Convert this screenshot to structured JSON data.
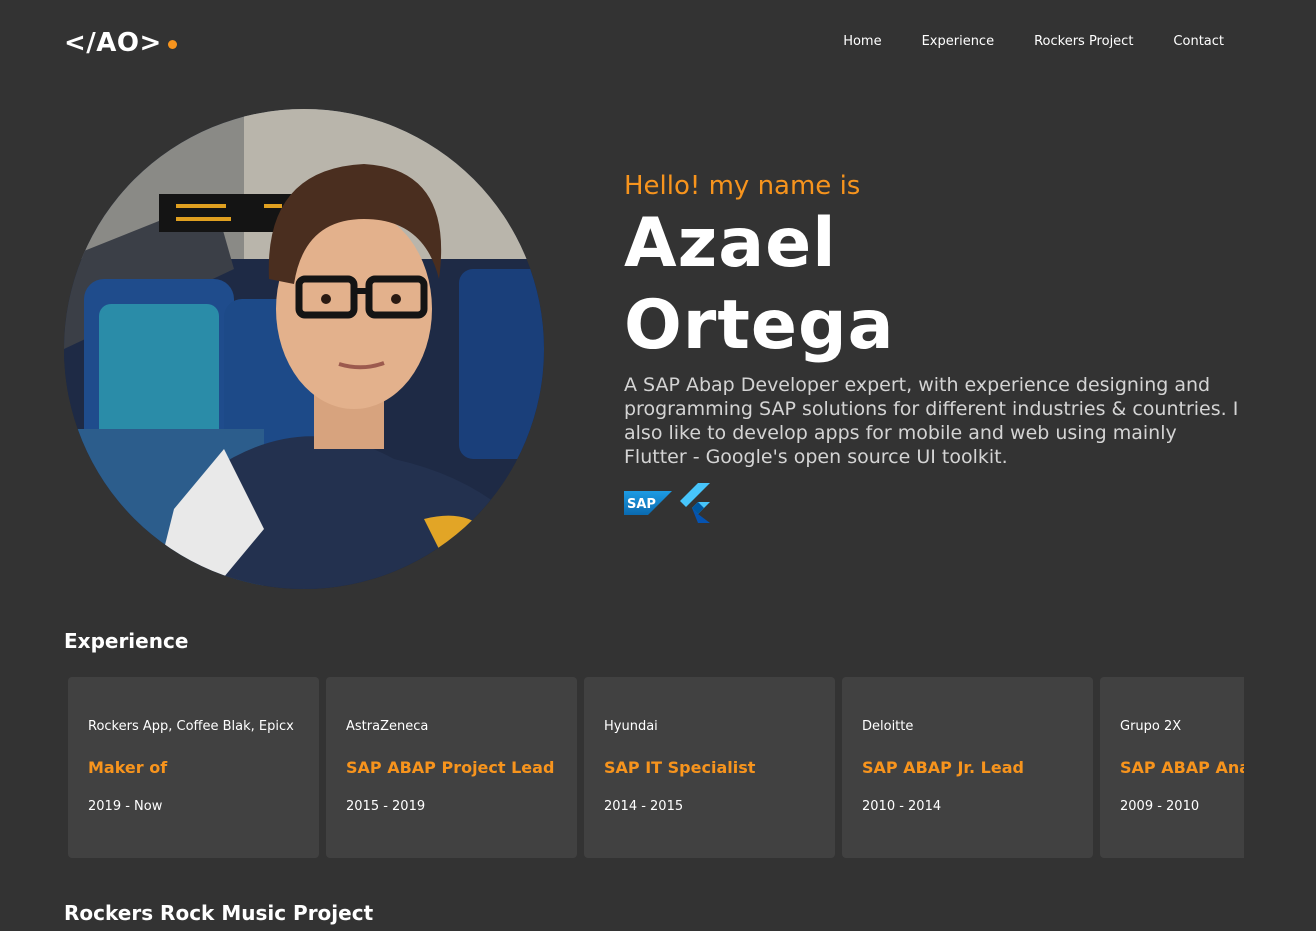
{
  "header": {
    "logo_text": "</AO>",
    "logo_accent_color": "#f7941d",
    "nav": [
      {
        "label": "Home"
      },
      {
        "label": "Experience"
      },
      {
        "label": "Rockers Project"
      },
      {
        "label": "Contact"
      }
    ]
  },
  "hero": {
    "greeting": "Hello! my name is",
    "first_name": "Azael",
    "last_name": "Ortega",
    "bio": "A SAP Abap Developer expert, with experience designing and programming SAP solutions for different industries & countries. I also like to develop apps for mobile and web using mainly Flutter - Google's open source UI toolkit.",
    "photo_icon": "profile-photo",
    "tech_icons": [
      "sap-logo-icon",
      "flutter-logo-icon"
    ],
    "sap_logo_text": "SAP"
  },
  "experience": {
    "title": "Experience",
    "items": [
      {
        "company": "Rockers App, Coffee Blak, Epicx",
        "role": "Maker of",
        "period": "2019 - Now"
      },
      {
        "company": "AstraZeneca",
        "role": "SAP ABAP Project Lead",
        "period": "2015 - 2019"
      },
      {
        "company": "Hyundai",
        "role": "SAP IT Specialist",
        "period": "2014 - 2015"
      },
      {
        "company": "Deloitte",
        "role": "SAP ABAP Jr. Lead",
        "period": "2010 - 2014"
      },
      {
        "company": "Grupo 2X",
        "role": "SAP ABAP Analyst",
        "period": "2009 - 2010"
      }
    ]
  },
  "rockers": {
    "title": "Rockers Rock Music Project"
  },
  "colors": {
    "background": "#333333",
    "card": "#414141",
    "accent": "#f7941d"
  }
}
